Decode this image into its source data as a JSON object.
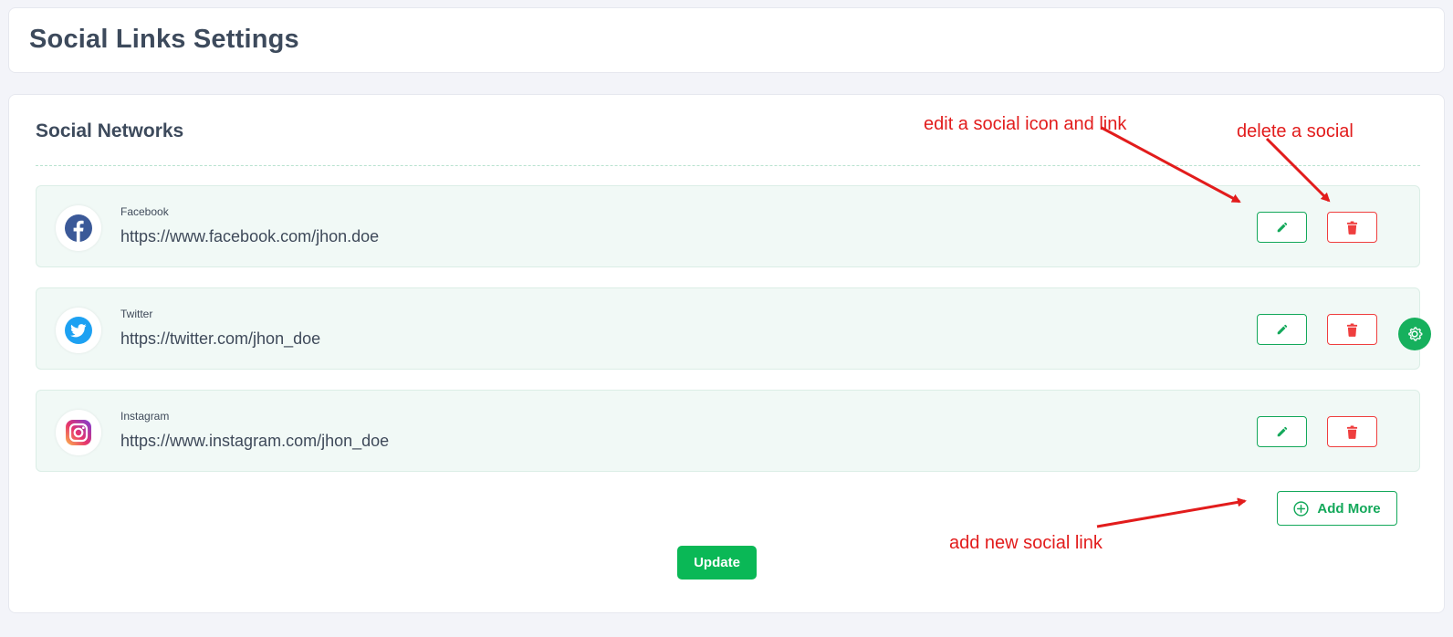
{
  "page": {
    "title": "Social Links Settings"
  },
  "section": {
    "title": "Social Networks"
  },
  "socials": [
    {
      "name": "Facebook",
      "url": "https://www.facebook.com/jhon.doe",
      "icon": "facebook-icon",
      "color": "#3b5998"
    },
    {
      "name": "Twitter",
      "url": "https://twitter.com/jhon_doe",
      "icon": "twitter-icon",
      "color": "#1da1f2"
    },
    {
      "name": "Instagram",
      "url": "https://www.instagram.com/jhon_doe",
      "icon": "instagram-icon",
      "color": "#d6249f"
    }
  ],
  "actions": {
    "edit_icon": "pencil-icon",
    "delete_icon": "trash-icon",
    "add_more_label": "Add More",
    "add_icon": "plus-circle-icon",
    "update_label": "Update"
  },
  "annotations": {
    "edit": "edit a social icon and link",
    "delete": "delete a social",
    "add": "add new social link"
  },
  "colors": {
    "accent": "#13a85a",
    "danger": "#ef3e3e",
    "annotation": "#e21c1c",
    "row_background": "#f1f9f6",
    "page_background": "#f3f4f9"
  }
}
